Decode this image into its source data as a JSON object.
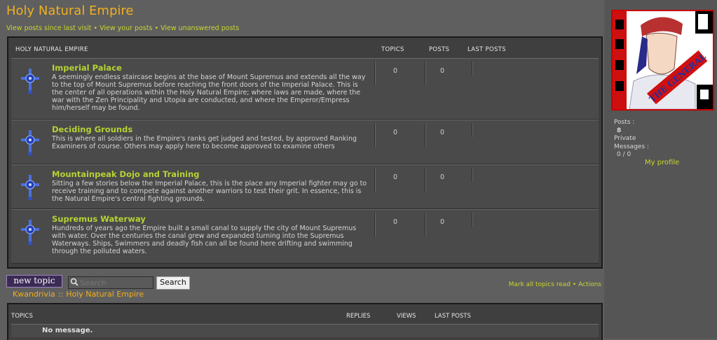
{
  "page": {
    "title": "Holy Natural Empire",
    "top_links": [
      "View posts since last visit",
      "View your posts",
      "View unanswered posts"
    ],
    "link_separator": "•"
  },
  "forum_table": {
    "headers": {
      "forum": "HOLY NATURAL EMPIRE",
      "topics": "TOPICS",
      "posts": "POSTS",
      "last_posts": "LAST POSTS"
    },
    "rows": [
      {
        "title": "Imperial Palace",
        "description": "A seemingly endless staircase begins at the base of Mount Supremus and extends all the way to the top of Mount Supremus before reaching the front doors of the Imperial Palace. This is the center of all operations within the Holy Natural Empire; where laws are made, where the war with the Zen Principality and Utopia are conducted, and where the Emperor/Empress him/herself may be found.",
        "topics": "0",
        "posts": "0",
        "icon": "cross-emblem-icon"
      },
      {
        "title": "Deciding Grounds",
        "description": "This is where all soldiers in the Empire's ranks get judged and tested, by approved Ranking Examiners of course. Others may apply here to become approved to examine others",
        "topics": "0",
        "posts": "0",
        "icon": "cross-emblem-icon"
      },
      {
        "title": "Mountainpeak Dojo and Training",
        "description": "Sitting a few stories below the Imperial Palace, this is the place any Imperial fighter may go to receive training and to compete against another warriors to test their grit. In essence, this is the Natural Empire's central fighting grounds.",
        "topics": "0",
        "posts": "0",
        "icon": "cross-emblem-icon"
      },
      {
        "title": "Supremus Waterway",
        "description": "Hundreds of years ago the Empire built a small canal to supply the city of Mount Supremus with water. Over the centuries the canal grew and expanded turning into the Supremus Waterways. Ships, Swimmers and deadly fish can all be found here drifting and swimming through the polluted waters.",
        "topics": "0",
        "posts": "0",
        "icon": "cross-emblem-icon"
      }
    ]
  },
  "actions": {
    "new_topic_label": "new topic",
    "search_placeholder": "Search",
    "search_button": "Search",
    "mark_read": "Mark all topics read",
    "separator": "•",
    "actions_label": "Actions"
  },
  "breadcrumb": {
    "site": "Kwandrivia",
    "separator": "::",
    "forum": "Holy Natural Empire"
  },
  "topics_table": {
    "headers": {
      "topics": "TOPICS",
      "replies": "REPLIES",
      "views": "VIEWS",
      "last_posts": "LAST POSTS"
    },
    "empty_message": "No message."
  },
  "sidebar": {
    "avatar_caption": "THE GENERAL",
    "posts_label": "Posts :",
    "posts_value": "8",
    "pm_label_1": "Private",
    "pm_label_2": "Messages :",
    "pm_value": "0 / 0",
    "profile_link": "My profile"
  },
  "colors": {
    "accent_orange": "#f0b020",
    "link_green": "#c9d62e",
    "forum_title": "#b5d333",
    "background": "#5f5f5f"
  }
}
